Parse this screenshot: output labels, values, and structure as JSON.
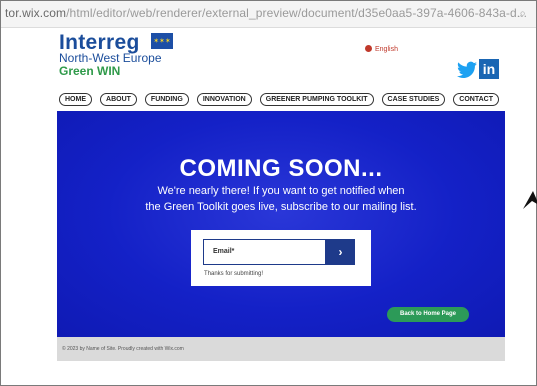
{
  "browser": {
    "url_host": "tor.wix.com",
    "url_path": "/html/editor/web/renderer/external_preview/document/d35e0aa5-397a-4606-843a-d...",
    "extra_icon": "search-icon"
  },
  "brand": {
    "title": "Interreg",
    "subtitle": "North-West Europe",
    "project": "Green WIN",
    "flag_icon": "eu-flag-icon"
  },
  "language": {
    "label": "English",
    "icon": "globe-icon"
  },
  "social": {
    "twitter_icon": "twitter-icon",
    "linkedin_label": "in"
  },
  "nav": {
    "items": [
      {
        "label": "HOME"
      },
      {
        "label": "ABOUT"
      },
      {
        "label": "FUNDING"
      },
      {
        "label": "INNOVATION"
      },
      {
        "label": "GREENER PUMPING TOOLKIT"
      },
      {
        "label": "CASE STUDIES"
      },
      {
        "label": "CONTACT"
      }
    ]
  },
  "hero": {
    "title": "COMING SOON...",
    "line1": "We're nearly there! If you want to get notified when",
    "line2": "the Green Toolkit goes live, subscribe to our mailing list."
  },
  "form": {
    "email_label": "Email*",
    "submit_icon": "chevron-right-icon",
    "submit_glyph": "›",
    "thanks": "Thanks for submitting!"
  },
  "back_button": {
    "label": "Back to Home Page"
  },
  "footer": {
    "text": "© 2023 by Name of Site. Proudly created with Wix.com"
  },
  "colors": {
    "brand_blue": "#1b4d9b",
    "brand_green": "#2f9a4a",
    "hero_blue": "#1421c7",
    "button_navy": "#1e3a8a",
    "back_button_green": "#2c9a58",
    "footer_gray": "#dadada"
  }
}
